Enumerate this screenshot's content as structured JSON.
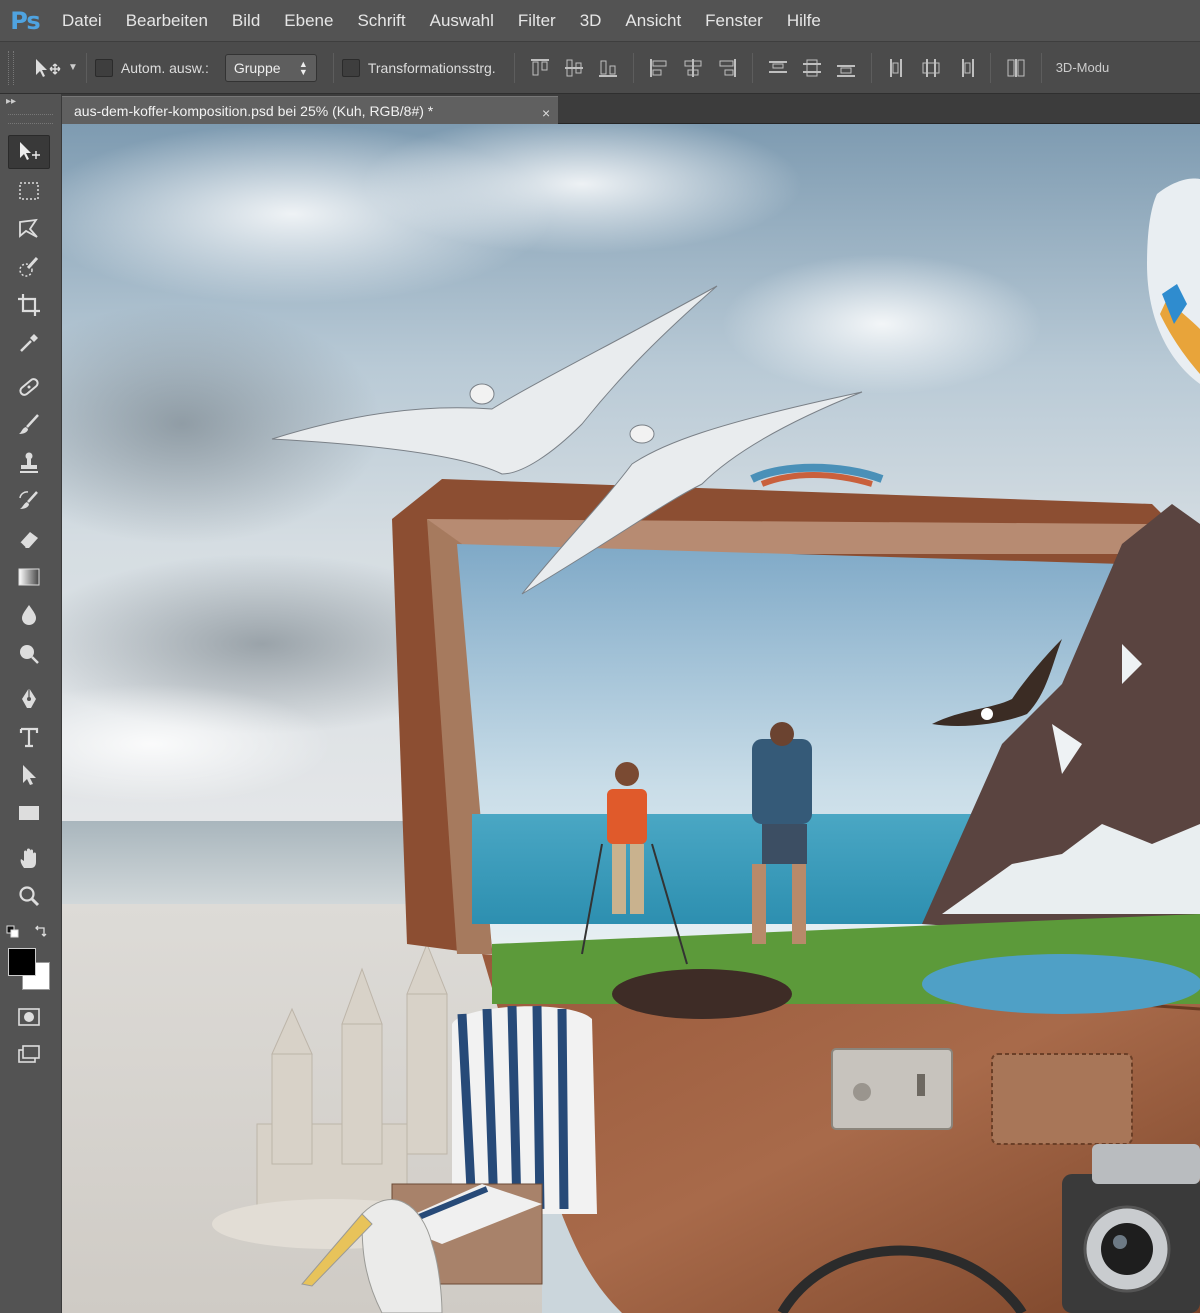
{
  "app": {
    "logo": "Ps"
  },
  "menu": [
    "Datei",
    "Bearbeiten",
    "Bild",
    "Ebene",
    "Schrift",
    "Auswahl",
    "Filter",
    "3D",
    "Ansicht",
    "Fenster",
    "Hilfe"
  ],
  "options": {
    "auto_select_label": "Autom. ausw.:",
    "auto_select_value": "Gruppe",
    "transform_label": "Transformationsstrg.",
    "mode_label": "3D-Modu"
  },
  "toolbox": {
    "collapse": "▸▸"
  },
  "document": {
    "tab_title": "aus-dem-koffer-komposition.psd bei 25% (Kuh, RGB/8#) *",
    "close_glyph": "×"
  },
  "icons": [
    "move-icon",
    "rect-marquee-icon",
    "lasso-icon",
    "quick-select-icon",
    "crop-icon",
    "eyedropper-icon",
    "healing-icon",
    "brush-icon",
    "stamp-icon",
    "history-brush-icon",
    "eraser-icon",
    "gradient-icon",
    "blur-icon",
    "dodge-icon",
    "pen-icon",
    "type-icon",
    "path-select-icon",
    "shape-icon",
    "hand-icon",
    "zoom-icon"
  ],
  "colors": {
    "foreground": "#000000",
    "background": "#ffffff",
    "ui_bg": "#535353",
    "accent": "#4fa3e0"
  }
}
